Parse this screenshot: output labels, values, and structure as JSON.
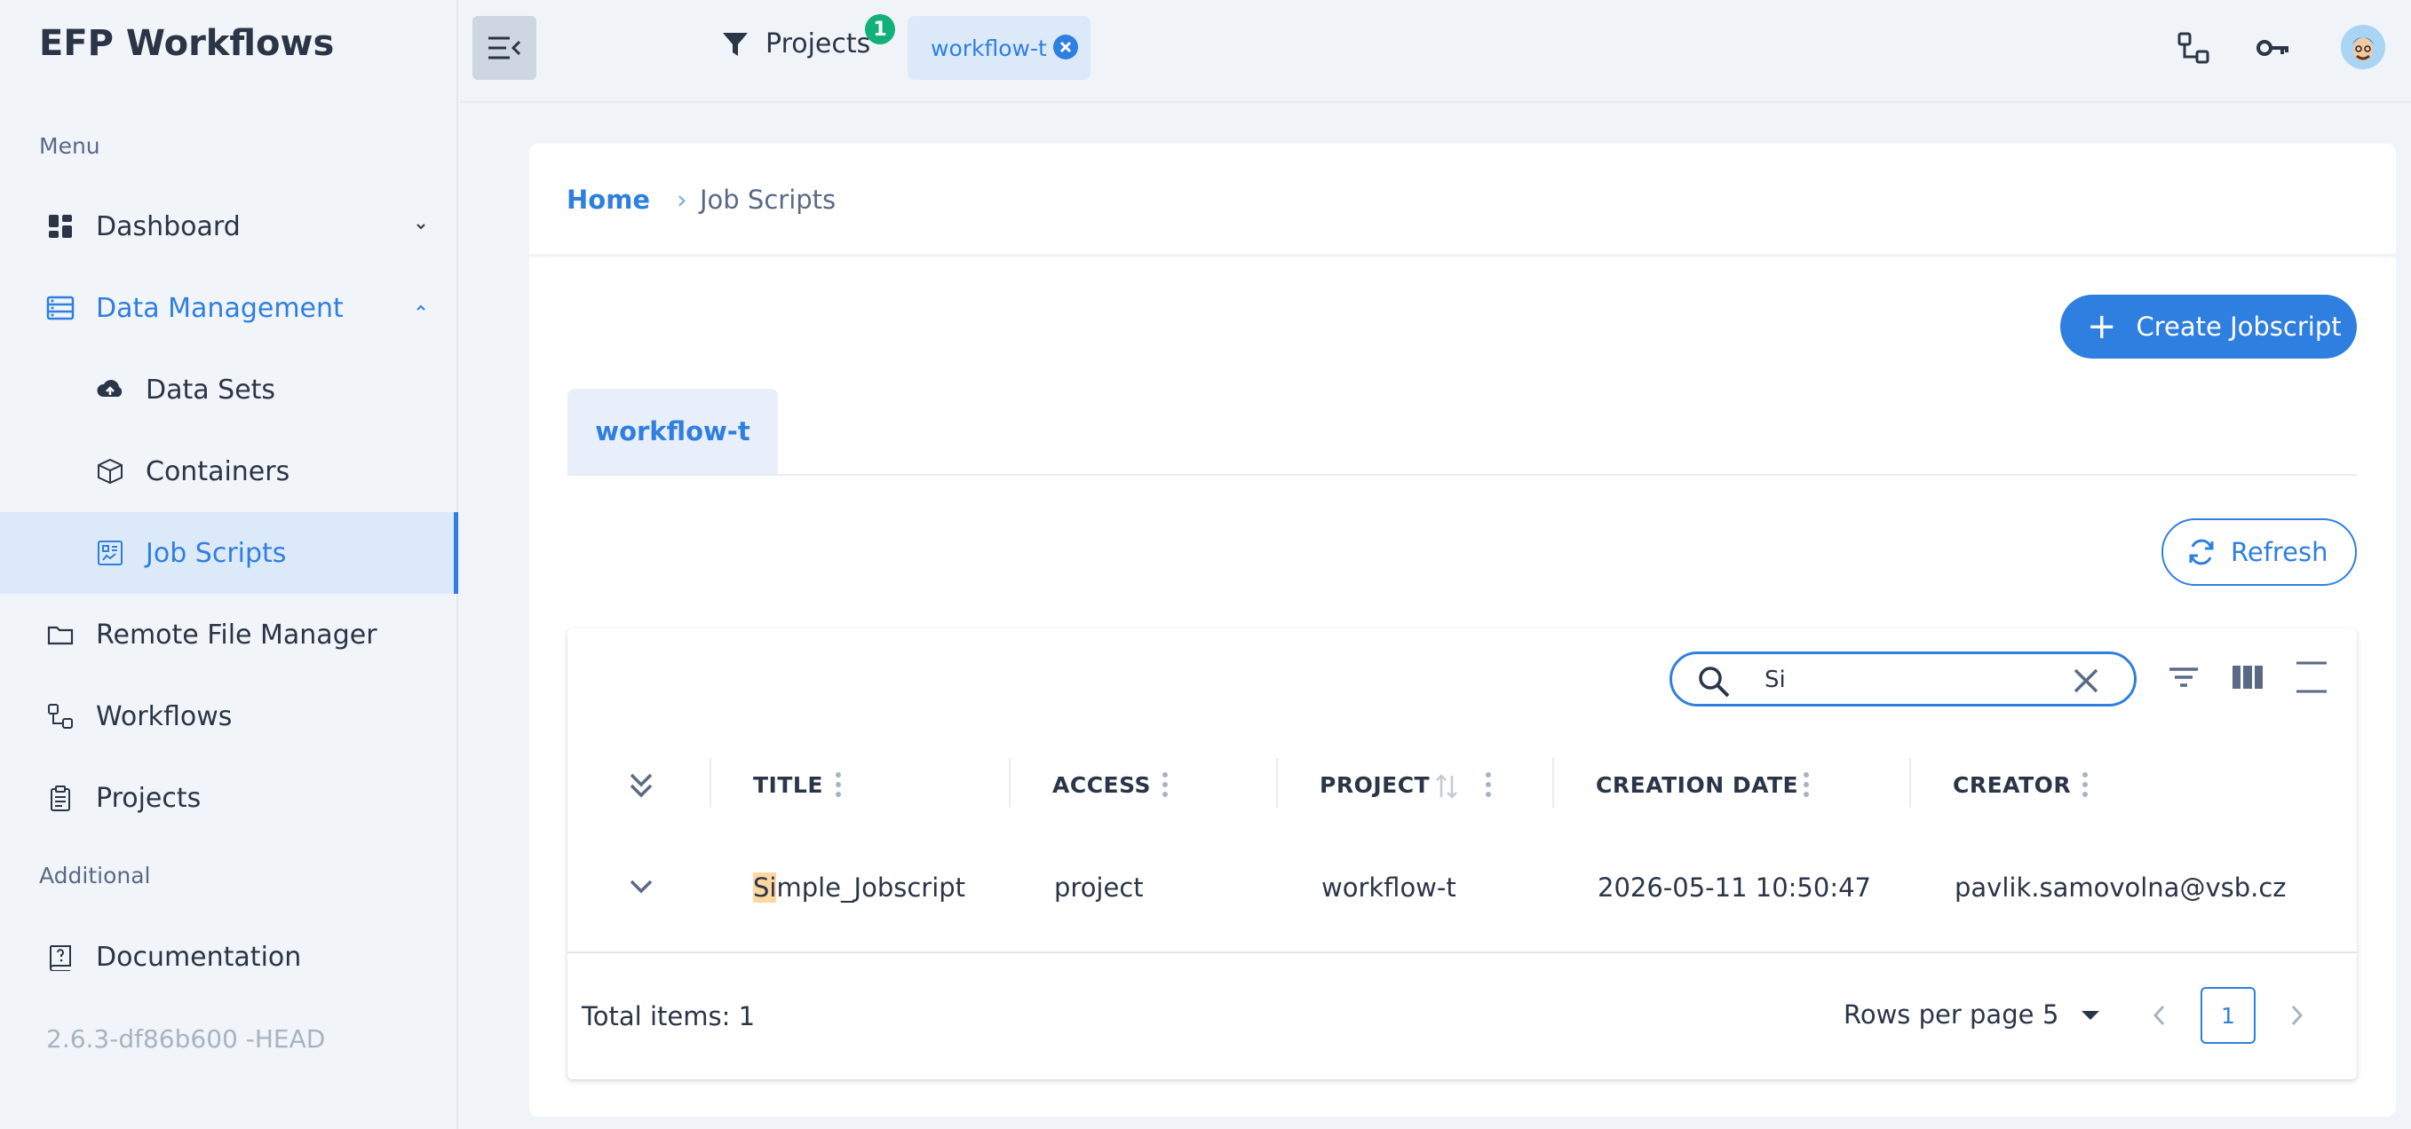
{
  "app": {
    "title": "EFP Workflows",
    "version": "2.6.3-df86b600 -HEAD"
  },
  "sidebar": {
    "menu_label": "Menu",
    "additional_label": "Additional",
    "items": [
      {
        "label": "Dashboard"
      },
      {
        "label": "Data Management"
      },
      {
        "label": "Data Sets"
      },
      {
        "label": "Containers"
      },
      {
        "label": "Job Scripts"
      },
      {
        "label": "Remote File Manager"
      },
      {
        "label": "Workflows"
      },
      {
        "label": "Projects"
      },
      {
        "label": "Documentation"
      }
    ]
  },
  "header": {
    "projects_label": "Projects",
    "projects_count": "1",
    "selected_project": "workflow-t"
  },
  "breadcrumb": {
    "home": "Home",
    "separator": "›",
    "current": "Job Scripts"
  },
  "actions": {
    "create_label": "Create Jobscript",
    "refresh_label": "Refresh"
  },
  "tabs": [
    {
      "label": "workflow-t"
    }
  ],
  "table": {
    "search_value": "Si",
    "columns": [
      "TITLE",
      "ACCESS",
      "PROJECT",
      "CREATION DATE",
      "CREATOR"
    ],
    "rows": [
      {
        "title_match": "Si",
        "title_rest": "mple_Jobscript",
        "access": "project",
        "project": "workflow-t",
        "creation_date": "2026-05-11 10:50:47",
        "creator": "pavlik.samovolna@vsb.cz"
      }
    ],
    "total_label": "Total items: 1",
    "rows_per_page_label": "Rows per page",
    "rows_per_page": "5",
    "current_page": "1"
  },
  "colors": {
    "accent": "#2f7fe0",
    "badge": "#13b07b",
    "highlight": "#ffd7a0"
  }
}
